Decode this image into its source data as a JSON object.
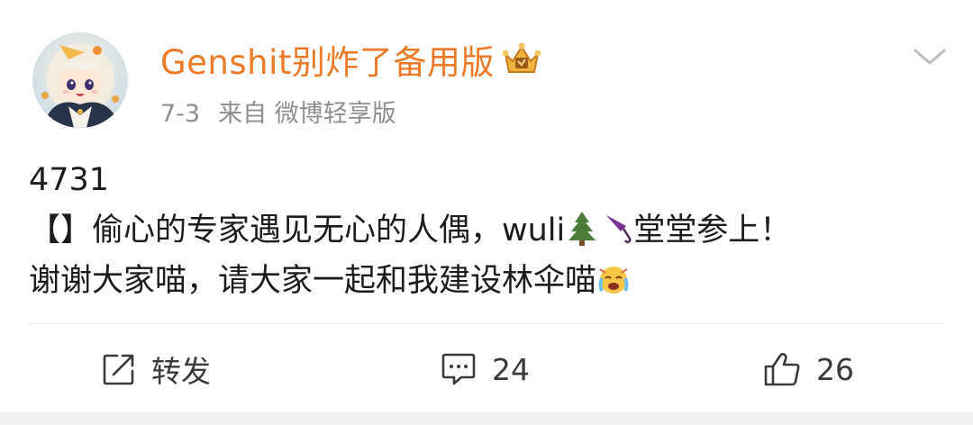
{
  "user": {
    "name": "Genshit别炸了备用版",
    "avatar_icon": "anime-avatar-icon",
    "badge_icon": "crown-badge-icon"
  },
  "meta": {
    "date": "7-3",
    "source": "来自 微博轻享版"
  },
  "content": {
    "line1": "4731",
    "line2_text": "【】偷心的专家遇见无心的人偶，wuli",
    "line2_tree_emoji": "🌲",
    "line2_umbrella_emoji": "🌂",
    "line2_end": "堂堂参上！",
    "line3_text": "谢谢大家喵，请大家一起和我建设林伞喵",
    "line3_emoji": "😭"
  },
  "actions": {
    "repost_label": "转发",
    "comment_count": "24",
    "like_count": "26"
  },
  "colors": {
    "username": "#ee7a27",
    "meta": "#8f8f8f",
    "text": "#1c1c1c",
    "icon": "#3a3a3a"
  }
}
